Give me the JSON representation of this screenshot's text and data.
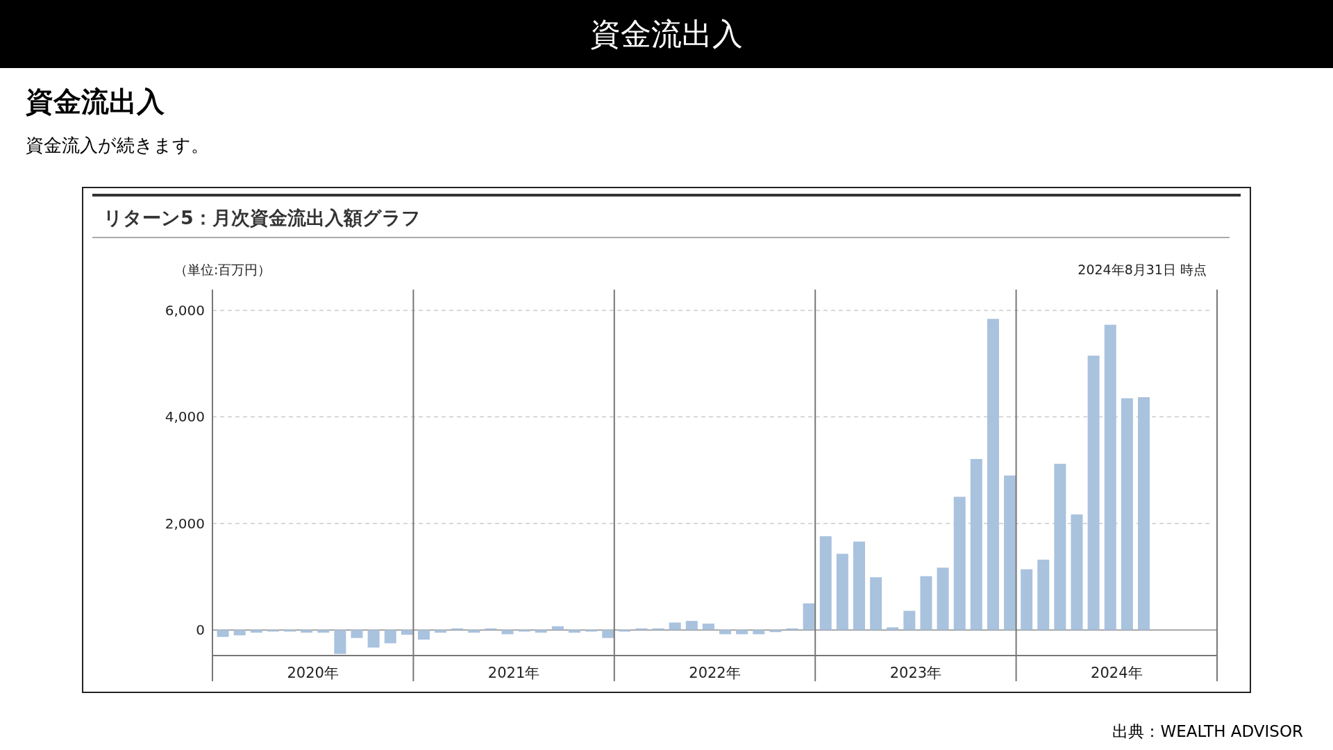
{
  "header": {
    "title": "資金流出入"
  },
  "section": {
    "heading": "資金流出入",
    "description": "資金流入が続きます。"
  },
  "chart_card": {
    "title": "リターン5：月次資金流出入額グラフ",
    "unit_note": "（単位:百万円）",
    "as_of": "2024年8月31日 時点",
    "year_labels": [
      "2020年",
      "2021年",
      "2022年",
      "2023年",
      "2024年"
    ],
    "chart_data": {
      "type": "bar",
      "grid": true,
      "ylim": [
        -480,
        6390
      ],
      "yticks": [
        0,
        {
          "value": 2000,
          "label": "2,000"
        },
        {
          "value": 4000,
          "label": "4,000"
        },
        {
          "value": 6000,
          "label": "6,000"
        }
      ],
      "series": [
        {
          "color": "#a9c2de",
          "values": [
            -130,
            -100,
            -50,
            -30,
            -30,
            -50,
            -50,
            -450,
            -150,
            -330,
            -250,
            -90,
            -180,
            -50,
            30,
            -50,
            30,
            -80,
            -30,
            -50,
            70,
            -50,
            -30,
            -150,
            -30,
            30,
            30,
            140,
            170,
            120,
            -80,
            -80,
            -80,
            -40,
            30,
            500,
            1760,
            1430,
            1660,
            990,
            50,
            360,
            1010,
            1170,
            2500,
            3210,
            5840,
            2900,
            1140,
            1320,
            3120,
            2170,
            5150,
            5730,
            4350,
            4370,
            null,
            null,
            null,
            null
          ]
        }
      ]
    }
  },
  "source": {
    "text": "出典：WEALTH ADVISOR"
  }
}
